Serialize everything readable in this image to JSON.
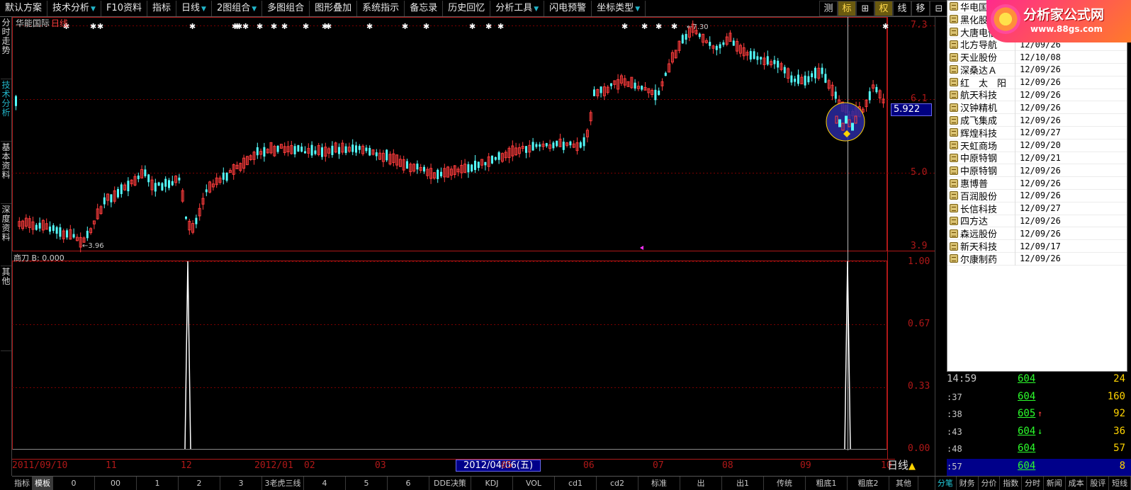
{
  "toolbar": {
    "items": [
      {
        "label": "默认方案",
        "dd": false
      },
      {
        "label": "技术分析",
        "dd": true
      },
      {
        "label": "F10资料",
        "dd": false
      },
      {
        "label": "指标",
        "dd": false
      },
      {
        "label": "日线",
        "dd": true
      },
      {
        "label": "2图组合",
        "dd": true
      },
      {
        "label": "多图组合",
        "dd": false
      },
      {
        "label": "图形叠加",
        "dd": false
      },
      {
        "label": "系统指示",
        "dd": false
      },
      {
        "label": "备忘录",
        "dd": false
      },
      {
        "label": "历史回忆",
        "dd": false
      },
      {
        "label": "分析工具",
        "dd": true
      },
      {
        "label": "闪电预警",
        "dd": false
      },
      {
        "label": "坐标类型",
        "dd": true
      }
    ],
    "right_buttons": [
      "测",
      "标",
      "⊞",
      "权",
      "线",
      "移",
      "⊟"
    ]
  },
  "left_tabs": [
    "分时走势",
    "技术分析",
    "基本资料",
    "深度资料",
    "其他"
  ],
  "main": {
    "stock_name": "华能国际",
    "period": "日线",
    "high_label": "7.30",
    "low_label": "3.96",
    "current_price": "5.922",
    "y_axis_labels": [
      "7.3",
      "6.1",
      "5.0",
      "3.9"
    ]
  },
  "sub": {
    "title": "商刀 B: 0.000",
    "y_axis_labels": [
      "1.00",
      "0.67",
      "0.33",
      "0.00"
    ]
  },
  "date_axis": {
    "labels": [
      "2011/09/10",
      "11",
      "12",
      "2012/01",
      "02",
      "03",
      "04",
      "05",
      "06",
      "07",
      "08",
      "09",
      "10"
    ],
    "selected_date": "2012/04/06(五)",
    "period_button": "日线"
  },
  "bottom_tabs": [
    "指标",
    "模板",
    "0",
    "00",
    "1",
    "2",
    "3",
    "3老虎三线",
    "4",
    "5",
    "6",
    "DDE决策",
    "KDJ",
    "VOL",
    "cd1",
    "cd2",
    "标准",
    "出",
    "出1",
    "传统",
    "粗底1",
    "粗底2",
    "其他"
  ],
  "popup": {
    "rows": [
      {
        "name": "华电国际",
        "date": ""
      },
      {
        "name": "黑化股份",
        "date": ""
      },
      {
        "name": "大唐电信",
        "date": ""
      },
      {
        "name": "北方导航",
        "date": "12/09/26"
      },
      {
        "name": "天业股份",
        "date": "12/10/08"
      },
      {
        "name": "深桑达Ａ",
        "date": "12/09/26"
      },
      {
        "name": "红　太　阳",
        "date": "12/09/26"
      },
      {
        "name": "航天科技",
        "date": "12/09/26"
      },
      {
        "name": "汉钟精机",
        "date": "12/09/26"
      },
      {
        "name": "成飞集成",
        "date": "12/09/26"
      },
      {
        "name": "辉煌科技",
        "date": "12/09/27"
      },
      {
        "name": "天虹商场",
        "date": "12/09/20"
      },
      {
        "name": "中原特钢",
        "date": "12/09/21"
      },
      {
        "name": "中原特钢",
        "date": "12/09/26"
      },
      {
        "name": "惠博普",
        "date": "12/09/26"
      },
      {
        "name": "百润股份",
        "date": "12/09/26"
      },
      {
        "name": "长信科技",
        "date": "12/09/27"
      },
      {
        "name": "四方达",
        "date": "12/09/26"
      },
      {
        "name": "森远股份",
        "date": "12/09/26"
      },
      {
        "name": "新天科技",
        "date": "12/09/17"
      },
      {
        "name": "尔康制药",
        "date": "12/09/26"
      }
    ]
  },
  "logo": {
    "title": "分析家公式网",
    "url": "www.88gs.com"
  },
  "ticks": [
    {
      "time": "14:59",
      "price": "604",
      "arrow": "",
      "vol": "24"
    },
    {
      "time": ":37",
      "price": "604",
      "arrow": "",
      "vol": "160"
    },
    {
      "time": ":38",
      "price": "605",
      "arrow": "↑",
      "vol": "92"
    },
    {
      "time": ":43",
      "price": "604",
      "arrow": "↓",
      "vol": "36"
    },
    {
      "time": ":48",
      "price": "604",
      "arrow": "",
      "vol": "57"
    },
    {
      "time": ":57",
      "price": "604",
      "arrow": "",
      "vol": "8"
    }
  ],
  "right_tabs": [
    "分笔",
    "财务",
    "分价",
    "指数",
    "分时",
    "新闻",
    "成本",
    "股评",
    "短线"
  ],
  "colors": {
    "up": "#ff3c3c",
    "down": "#54fcfc",
    "grid": "#7a0000",
    "signal": "#ffffff",
    "highlight_circle": "#2a2aa0"
  }
}
